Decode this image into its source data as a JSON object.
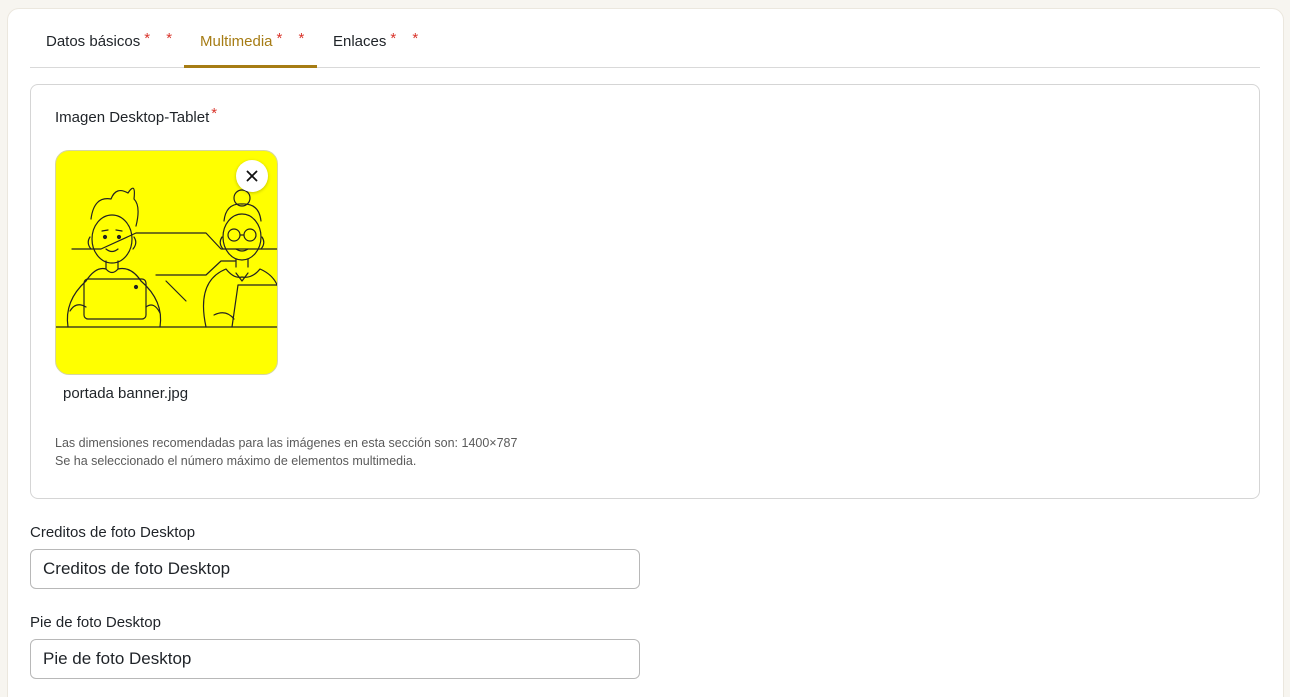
{
  "tabs": [
    {
      "label": "Datos básicos",
      "required_marks": "* *"
    },
    {
      "label": "Multimedia",
      "required_marks": "* *"
    },
    {
      "label": "Enlaces",
      "required_marks": "* *"
    }
  ],
  "media": {
    "label": "Imagen Desktop-Tablet",
    "required_mark": "*",
    "filename": "portada banner.jpg",
    "hint_dimensions": "Las dimensiones recomendadas para las imágenes en esta sección son: 1400×787",
    "hint_max": "Se ha seleccionado el número máximo de elementos multimedia.",
    "thumbnail_bg": "#ffff00",
    "remove_icon": "close-icon"
  },
  "fields": {
    "credits": {
      "label": "Creditos de foto Desktop",
      "placeholder": "Creditos de foto Desktop"
    },
    "caption": {
      "label": "Pie de foto Desktop",
      "placeholder": "Pie de foto Desktop"
    }
  },
  "colors": {
    "accent": "#a67c14",
    "required": "#d9342b"
  }
}
